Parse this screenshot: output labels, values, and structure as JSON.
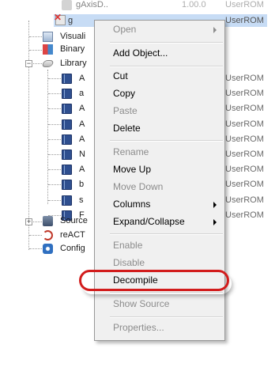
{
  "tree": {
    "top_row": {
      "label": "gAxisD..",
      "version": "1.00.0",
      "location": "UserROM"
    },
    "selected_row": {
      "label": "g",
      "location": "UserROM"
    },
    "visualization": {
      "label": "Visuali"
    },
    "binary": {
      "label": "Binary"
    },
    "library": {
      "label": "Library"
    },
    "library_items": [
      {
        "label": "A",
        "location": "UserROM"
      },
      {
        "label": "a",
        "location": "UserROM"
      },
      {
        "label": "A",
        "location": "UserROM"
      },
      {
        "label": "A",
        "location": "UserROM"
      },
      {
        "label": "A",
        "location": "UserROM"
      },
      {
        "label": "N",
        "location": "UserROM"
      },
      {
        "label": "A",
        "location": "UserROM"
      },
      {
        "label": "b",
        "location": "UserROM"
      },
      {
        "label": "s",
        "location": "UserROM"
      },
      {
        "label": "F",
        "location": "UserROM"
      }
    ],
    "source": {
      "label": "Source"
    },
    "react": {
      "label": "reACT"
    },
    "config": {
      "label": "Config"
    }
  },
  "menu": {
    "open": "Open",
    "add_object": "Add Object...",
    "cut": "Cut",
    "copy": "Copy",
    "paste": "Paste",
    "delete": "Delete",
    "rename": "Rename",
    "move_up": "Move Up",
    "move_down": "Move Down",
    "columns": "Columns",
    "expand_collapse": "Expand/Collapse",
    "enable": "Enable",
    "disable": "Disable",
    "decompile": "Decompile",
    "show_source": "Show Source",
    "properties": "Properties..."
  },
  "colors": {
    "highlight_ring": "#d21c1c",
    "selection": "#c7dcf5",
    "book_icon": "#2f4f8f"
  }
}
